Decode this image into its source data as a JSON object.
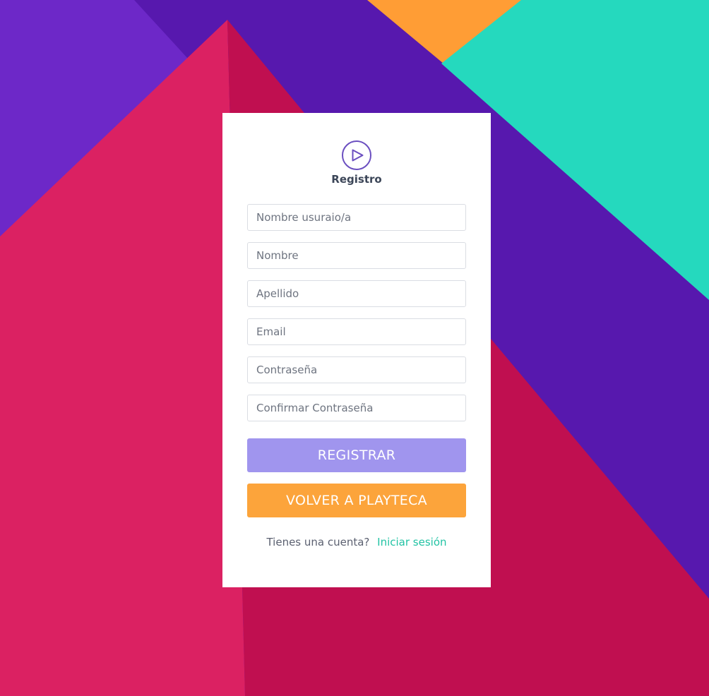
{
  "colors": {
    "background_violet": "#6d28c8",
    "background_indigo": "#5718ae",
    "background_pink": "#db2162",
    "background_crimson": "#c00f50",
    "background_orange": "#ff9d35",
    "background_teal": "#25d9be",
    "card": "#ffffff",
    "register_button": "#a095ee",
    "back_button": "#fca43b",
    "link": "#22c3a4",
    "logo": "#6b4fc0"
  },
  "logo": {
    "icon": "play-circle-icon"
  },
  "title": "Registro",
  "fields": [
    {
      "name": "username-input",
      "placeholder": "Nombre usuraio/a",
      "value": ""
    },
    {
      "name": "first-name-input",
      "placeholder": "Nombre",
      "value": ""
    },
    {
      "name": "last-name-input",
      "placeholder": "Apellido",
      "value": ""
    },
    {
      "name": "email-input",
      "placeholder": "Email",
      "value": ""
    },
    {
      "name": "password-input",
      "placeholder": "Contraseña",
      "value": ""
    },
    {
      "name": "confirm-password-input",
      "placeholder": "Confirmar Contraseña",
      "value": ""
    }
  ],
  "buttons": {
    "register": "REGISTRAR",
    "back": "VOLVER A PLAYTECA"
  },
  "footer": {
    "prompt": "Tienes una cuenta?",
    "link": "Iniciar sesión"
  }
}
